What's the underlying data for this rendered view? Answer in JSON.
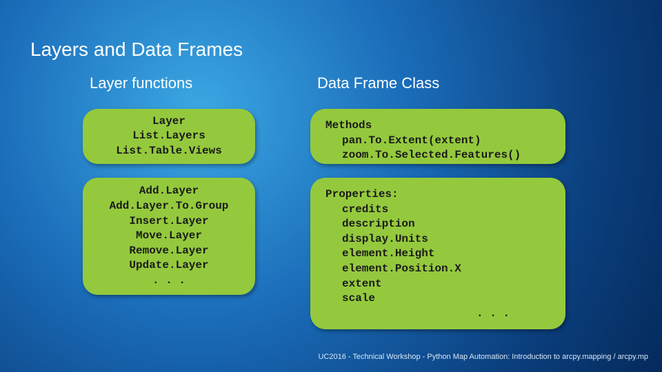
{
  "title": "Layers and Data Frames",
  "columns": {
    "left": {
      "heading": "Layer functions",
      "card1": {
        "lines": [
          "Layer",
          "List.Layers",
          "List.Table.Views"
        ]
      },
      "card2": {
        "lines": [
          "Add.Layer",
          "Add.Layer.To.Group",
          "Insert.Layer",
          "Move.Layer",
          "Remove.Layer",
          "Update.Layer",
          ". . ."
        ]
      }
    },
    "right": {
      "heading": "Data Frame Class",
      "card1": {
        "header": "Methods",
        "lines": [
          "pan.To.Extent(extent)",
          "zoom.To.Selected.Features()"
        ]
      },
      "card2": {
        "header": "Properties:",
        "lines": [
          "credits",
          "description",
          "display.Units",
          "element.Height",
          "element.Position.X",
          "extent",
          "scale"
        ],
        "ellipsis": ". . ."
      }
    }
  },
  "footer": "UC2016 - Technical Workshop - Python Map Automation: Introduction to arcpy.mapping / arcpy.mp"
}
